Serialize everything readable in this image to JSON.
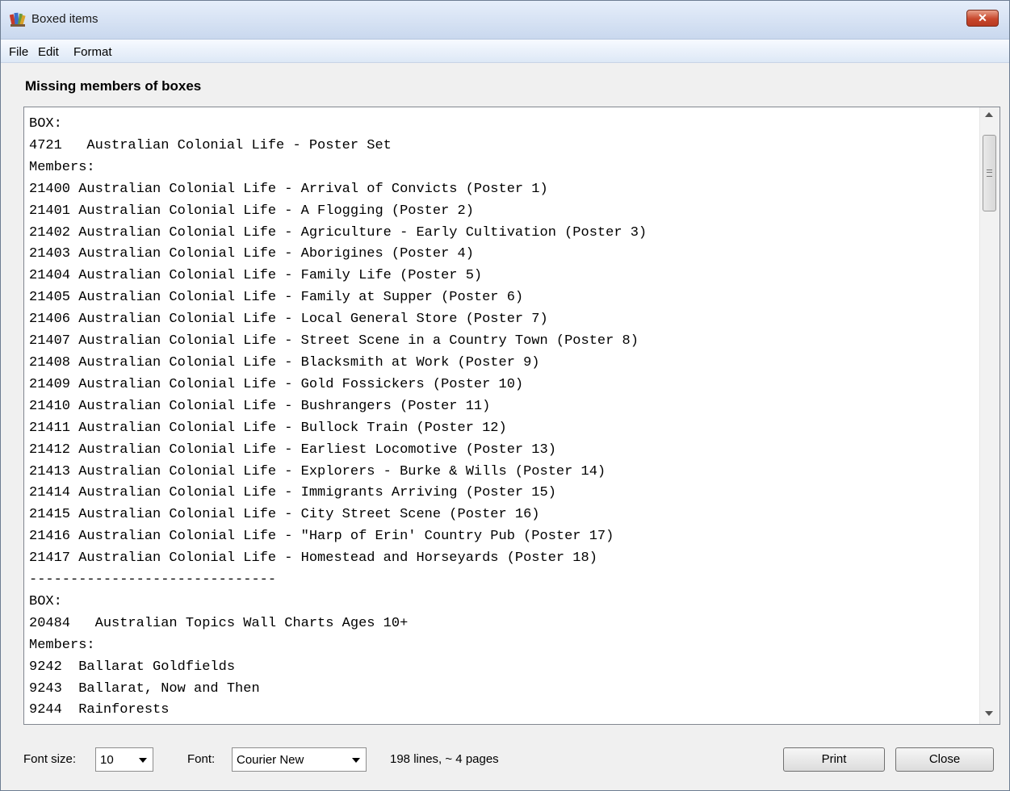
{
  "window": {
    "title": "Boxed items",
    "close_symbol": "✕"
  },
  "menu": [
    "File",
    "Edit",
    "Format"
  ],
  "heading": "Missing members of boxes",
  "textbox": {
    "lines": [
      "BOX:",
      "4721   Australian Colonial Life - Poster Set",
      "Members:",
      "21400 Australian Colonial Life - Arrival of Convicts (Poster 1)",
      "21401 Australian Colonial Life - A Flogging (Poster 2)",
      "21402 Australian Colonial Life - Agriculture - Early Cultivation (Poster 3)",
      "21403 Australian Colonial Life - Aborigines (Poster 4)",
      "21404 Australian Colonial Life - Family Life (Poster 5)",
      "21405 Australian Colonial Life - Family at Supper (Poster 6)",
      "21406 Australian Colonial Life - Local General Store (Poster 7)",
      "21407 Australian Colonial Life - Street Scene in a Country Town (Poster 8)",
      "21408 Australian Colonial Life - Blacksmith at Work (Poster 9)",
      "21409 Australian Colonial Life - Gold Fossickers (Poster 10)",
      "21410 Australian Colonial Life - Bushrangers (Poster 11)",
      "21411 Australian Colonial Life - Bullock Train (Poster 12)",
      "21412 Australian Colonial Life - Earliest Locomotive (Poster 13)",
      "21413 Australian Colonial Life - Explorers - Burke & Wills (Poster 14)",
      "21414 Australian Colonial Life - Immigrants Arriving (Poster 15)",
      "21415 Australian Colonial Life - City Street Scene (Poster 16)",
      "21416 Australian Colonial Life - \"Harp of Erin' Country Pub (Poster 17)",
      "21417 Australian Colonial Life - Homestead and Horseyards (Poster 18)",
      "------------------------------",
      "BOX:",
      "20484   Australian Topics Wall Charts Ages 10+",
      "Members:",
      "9242  Ballarat Goldfields",
      "9243  Ballarat, Now and Then",
      "9244  Rainforests"
    ]
  },
  "controls": {
    "font_size_label": "Font size:",
    "font_size_value": "10",
    "font_label": "Font:",
    "font_value": "Courier New",
    "status": "198 lines, ~ 4 pages",
    "print_label": "Print",
    "close_label": "Close"
  }
}
